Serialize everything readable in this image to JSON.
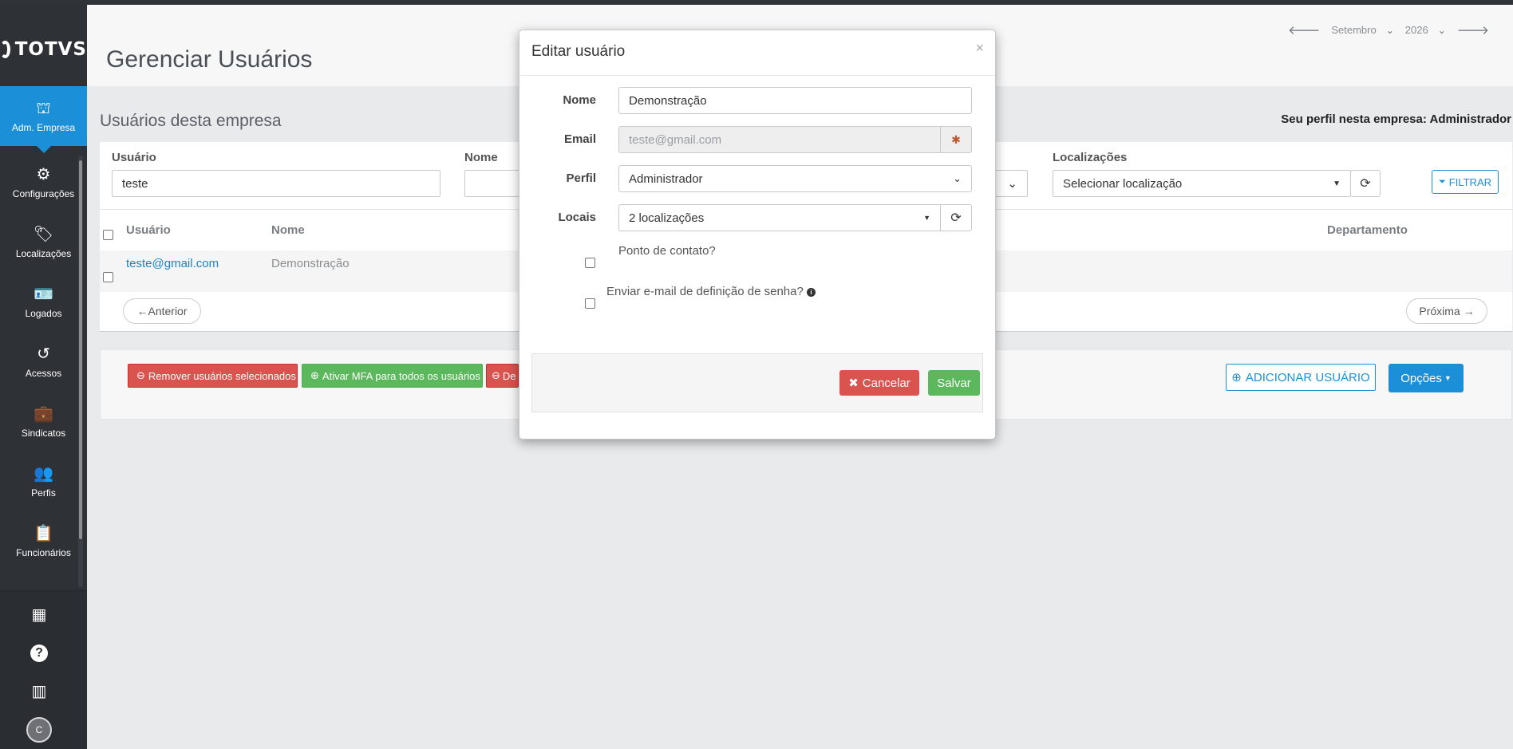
{
  "brand": {
    "logo_text": "TOTVS"
  },
  "sidebar": {
    "items": [
      {
        "label": "Adm. Empresa",
        "icon": "building-gear-icon",
        "glyph": "⛫"
      },
      {
        "label": "Configurações",
        "icon": "gear-icon",
        "glyph": "⚙"
      },
      {
        "label": "Localizações",
        "icon": "tag-icon",
        "glyph": "🏷"
      },
      {
        "label": "Logados",
        "icon": "id-card-icon",
        "glyph": "🪪"
      },
      {
        "label": "Acessos",
        "icon": "history-icon",
        "glyph": "↺"
      },
      {
        "label": "Sindicatos",
        "icon": "briefcase-icon",
        "glyph": "💼"
      },
      {
        "label": "Perfis",
        "icon": "users-icon",
        "glyph": "👥"
      },
      {
        "label": "Funcionários",
        "icon": "clipboard-user-icon",
        "glyph": "📋"
      }
    ],
    "bottom": [
      {
        "icon": "grid-apps-icon",
        "glyph": "▦"
      },
      {
        "icon": "help-icon",
        "glyph": "?"
      },
      {
        "icon": "company-icon",
        "glyph": "▥"
      }
    ],
    "avatar": "C"
  },
  "header": {
    "title": "Gerenciar Usuários",
    "month": "Setembro",
    "year": "2026"
  },
  "main": {
    "section_title": "Usuários desta empresa",
    "profile_label": "Seu perfil nesta empresa:",
    "profile_value": "Administrador",
    "filters": {
      "user_label": "Usuário",
      "user_value": "teste",
      "name_label": "Nome",
      "locations_label": "Localizações",
      "locations_value": "Selecionar localização",
      "filter_button": "FILTRAR"
    },
    "table": {
      "headers": [
        "Usuário",
        "Nome",
        "Departamento"
      ],
      "rows": [
        {
          "user": "teste@gmail.com",
          "name": "Demonstração"
        }
      ]
    },
    "pagination": {
      "prev": "←Anterior",
      "next": "Próxima →"
    },
    "actions": {
      "remove_selected": "Remover usuários selecionados",
      "enable_mfa": "Ativar MFA para todos os usuários",
      "third_prefix": "De",
      "add_user": "ADICIONAR USUÁRIO",
      "options": "Opções"
    }
  },
  "modal": {
    "title": "Editar usuário",
    "close": "×",
    "name_label": "Nome",
    "name_value": "Demonstração",
    "email_label": "Email",
    "email_value": "teste@gmail.com",
    "profile_label": "Perfil",
    "profile_value": "Administrador",
    "locals_label": "Locais",
    "locals_value": "2 localizações",
    "contact_label": "Ponto de contato?",
    "send_email_label": "Enviar e-mail de definição de senha?",
    "cancel": "Cancelar",
    "save": "Salvar"
  },
  "colors": {
    "accent": "#1b90d8",
    "sidebar": "#2e3136",
    "danger": "#d9534f",
    "success": "#5cb85c"
  }
}
